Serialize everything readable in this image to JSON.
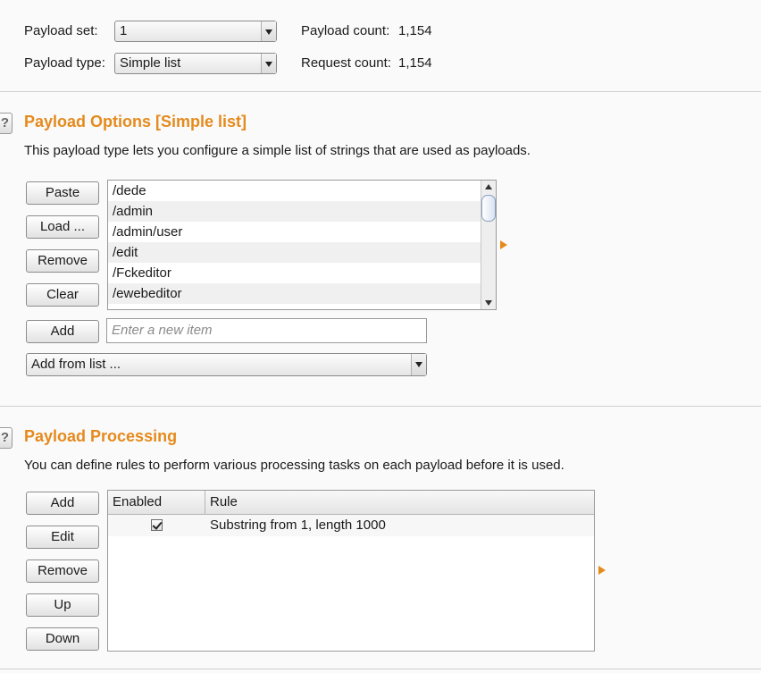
{
  "top": {
    "payload_set_label": "Payload set:",
    "payload_set_value": "1",
    "payload_count_label": "Payload count:",
    "payload_count_value": "1,154",
    "payload_type_label": "Payload type:",
    "payload_type_value": "Simple list",
    "request_count_label": "Request count:",
    "request_count_value": "1,154"
  },
  "options": {
    "help_glyph": "?",
    "title": "Payload Options [Simple list]",
    "description": "This payload type lets you configure a simple list of strings that are used as payloads.",
    "buttons": {
      "paste": "Paste",
      "load": "Load ...",
      "remove": "Remove",
      "clear": "Clear",
      "add": "Add"
    },
    "list_items": [
      "/dede",
      "/admin",
      "/admin/user",
      "/edit",
      "/Fckeditor",
      "/ewebeditor"
    ],
    "new_item_placeholder": "Enter a new item",
    "add_from_list": "Add from list ..."
  },
  "processing": {
    "help_glyph": "?",
    "title": "Payload Processing",
    "description": "You can define rules to perform various processing tasks on each payload before it is used.",
    "buttons": {
      "add": "Add",
      "edit": "Edit",
      "remove": "Remove",
      "up": "Up",
      "down": "Down"
    },
    "columns": {
      "enabled": "Enabled",
      "rule": "Rule"
    },
    "rows": [
      {
        "enabled": true,
        "rule": "Substring from 1, length 1000"
      }
    ]
  },
  "colors": {
    "accent": "#e58a1c"
  }
}
